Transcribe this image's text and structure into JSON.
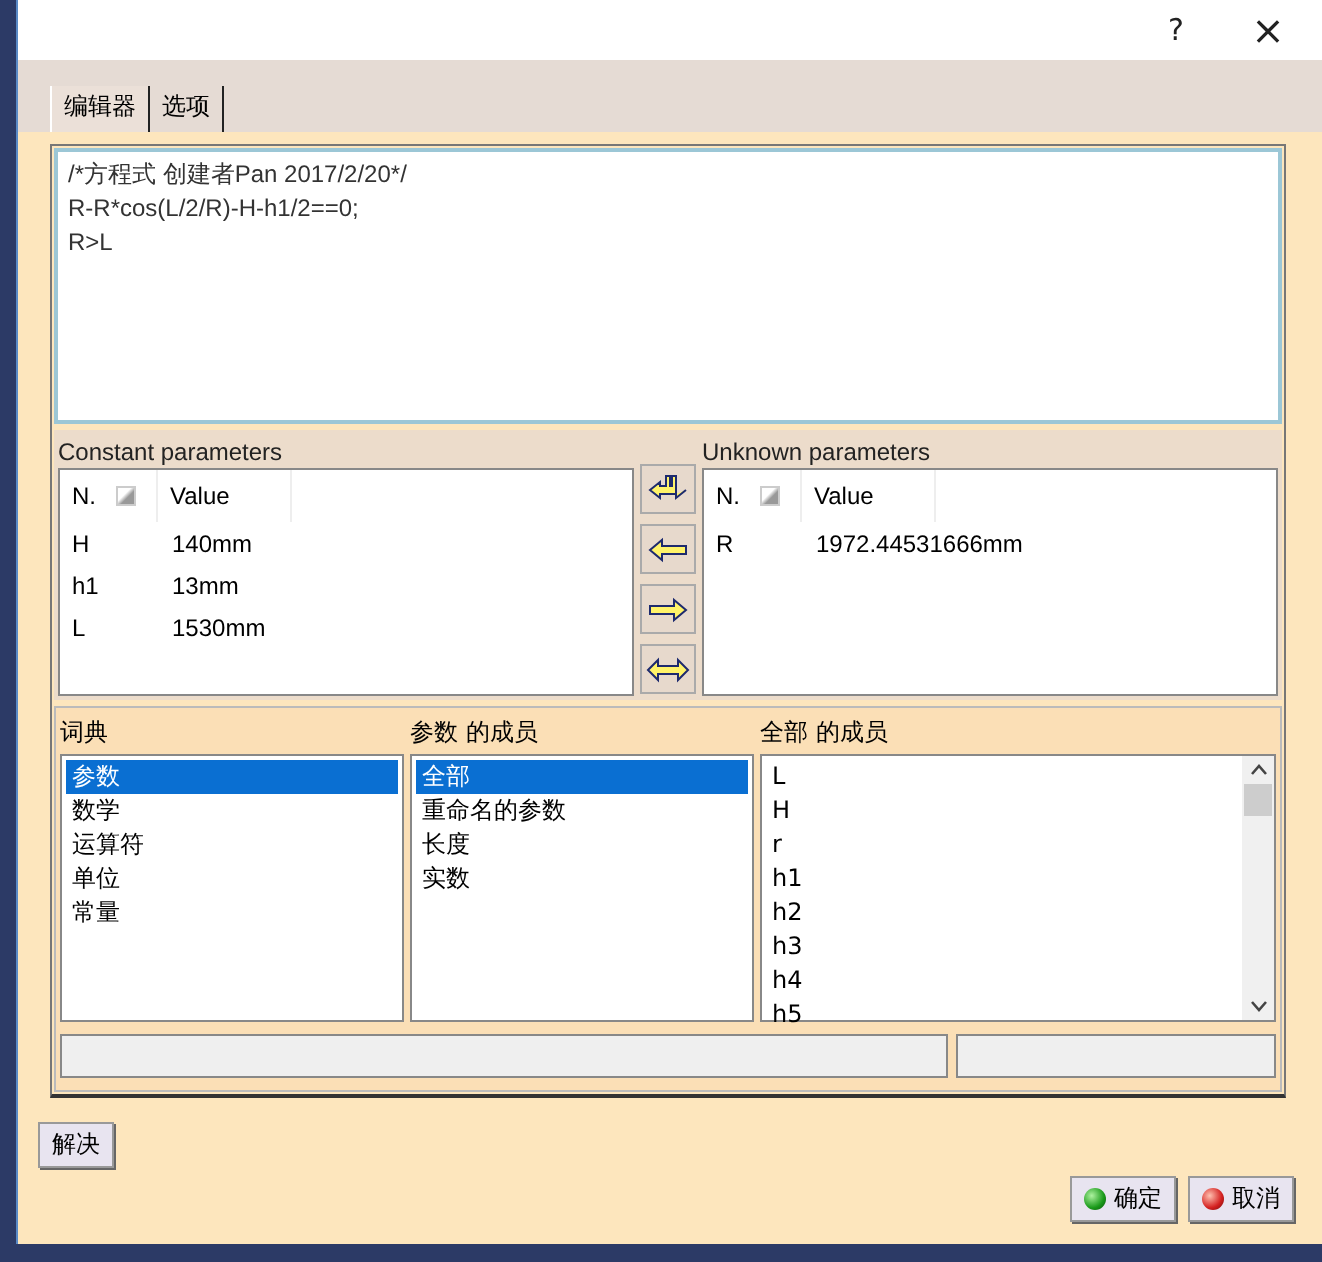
{
  "window": {
    "help": "?",
    "close": "×"
  },
  "tabs": [
    {
      "label": "编辑器",
      "selected": true
    },
    {
      "label": "选项",
      "selected": false
    }
  ],
  "editor": {
    "lines": [
      "/*方程式 创建者Pan 2017/2/20*/",
      "R-R*cos(L/2/R)-H-h1/2==0;",
      "R>L"
    ]
  },
  "constant_parameters": {
    "title": "Constant parameters",
    "columns": [
      "N.",
      "Value"
    ],
    "rows": [
      {
        "name": "H",
        "value": "140mm"
      },
      {
        "name": "h1",
        "value": "13mm"
      },
      {
        "name": "L",
        "value": "1530mm"
      }
    ]
  },
  "transfer_buttons": [
    {
      "kind": "swap"
    },
    {
      "kind": "left"
    },
    {
      "kind": "right"
    },
    {
      "kind": "both"
    }
  ],
  "unknown_parameters": {
    "title": "Unknown parameters",
    "columns": [
      "N.",
      "Value"
    ],
    "rows": [
      {
        "name": "R",
        "value": "1972.44531666mm"
      }
    ]
  },
  "lists": [
    {
      "title": "词典",
      "items": [
        {
          "label": "参数",
          "selected": true
        },
        {
          "label": "数学",
          "selected": false
        },
        {
          "label": "运算符",
          "selected": false
        },
        {
          "label": "单位",
          "selected": false
        },
        {
          "label": "常量",
          "selected": false
        }
      ]
    },
    {
      "title": "参数 的成员",
      "items": [
        {
          "label": "全部",
          "selected": true
        },
        {
          "label": "重命名的参数",
          "selected": false
        },
        {
          "label": "长度",
          "selected": false
        },
        {
          "label": "实数",
          "selected": false
        }
      ]
    },
    {
      "title": "全部 的成员",
      "scroll": true,
      "items": [
        {
          "label": "L",
          "selected": false
        },
        {
          "label": "H",
          "selected": false
        },
        {
          "label": "r",
          "selected": false
        },
        {
          "label": "h1",
          "selected": false
        },
        {
          "label": "h2",
          "selected": false
        },
        {
          "label": "h3",
          "selected": false
        },
        {
          "label": "h4",
          "selected": false
        },
        {
          "label": "h5",
          "selected": false
        }
      ]
    }
  ],
  "solve_button": "解决",
  "buttons": [
    {
      "label": "确定",
      "kind": "ok"
    },
    {
      "label": "取消",
      "kind": "cancel"
    }
  ]
}
